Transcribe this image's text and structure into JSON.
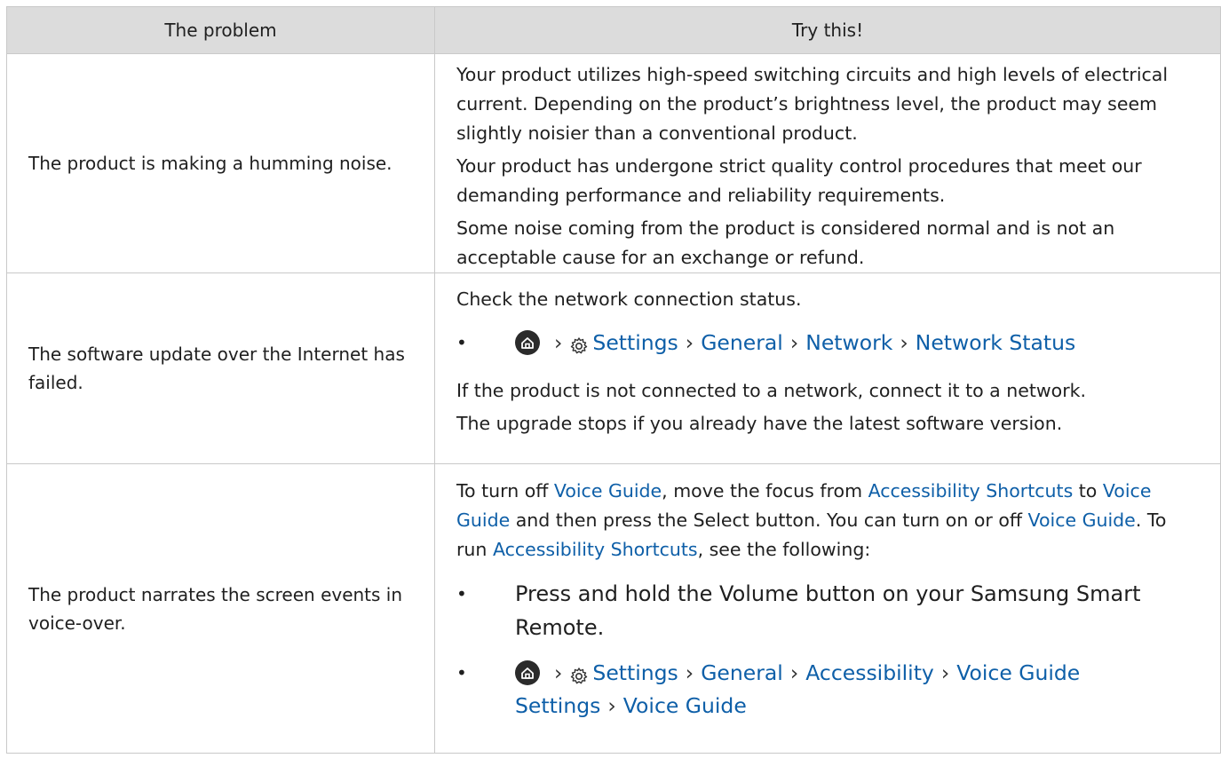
{
  "header": {
    "problem": "The problem",
    "try": "Try this!"
  },
  "rows": [
    {
      "problem": "The product is making a humming noise.",
      "paragraphs": [
        "Your product utilizes high-speed switching circuits and high levels of electrical current. Depending on the product’s brightness level, the product may seem slightly noisier than a conventional product.",
        "Your product has undergone strict quality control procedures that meet our demanding performance and reliability requirements.",
        "Some noise coming from the product is considered normal and is not an acceptable cause for an exchange or refund."
      ]
    },
    {
      "problem": "The software update over the Internet has failed.",
      "intro": "Check the network connection status.",
      "path": [
        "Settings",
        "General",
        "Network",
        "Network Status"
      ],
      "after": [
        "If the product is not connected to a network, connect it to a network.",
        "The upgrade stops if you already have the latest software version."
      ]
    },
    {
      "problem": "The product narrates the screen events in voice-over.",
      "intro": {
        "t1": "To turn off ",
        "l1": "Voice Guide",
        "t2": ", move the focus from ",
        "l2": "Accessibility Shortcuts",
        "t3": " to ",
        "l3": "Voice Guide",
        "t4": " and then press the Select button. You can turn on or off ",
        "l4": "Voice Guide",
        "t5": ". To run ",
        "l5": "Accessibility Shortcuts",
        "t6": ", see the following:"
      },
      "bullet1": "Press and hold the Volume button on your Samsung Smart Remote.",
      "path": [
        "Settings",
        "General",
        "Accessibility",
        "Voice Guide Settings",
        "Voice Guide"
      ]
    }
  ],
  "bullet_char": "•",
  "separator": "›",
  "colors": {
    "link": "#0e5fa8",
    "header_bg": "#dcdcdc",
    "border": "#c9c9c9"
  },
  "icons": {
    "home": "home-icon",
    "settings": "gear-icon"
  }
}
